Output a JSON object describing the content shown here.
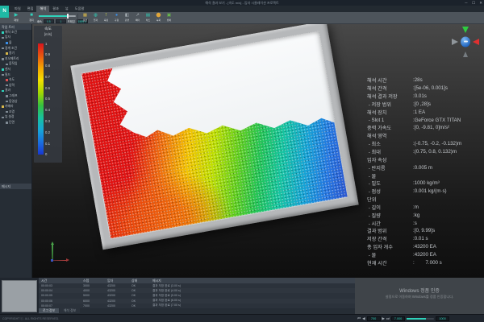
{
  "theme": {
    "accent_teal": "#2fd2bb",
    "panel_dark": "#272e36",
    "ribbon_gray": "#4d545b",
    "viewport_top": "#484848"
  },
  "window": {
    "title": "해석 결과 보기 - [속도 m/s] - 입자 시뮬레이션 프로젝트",
    "controls": [
      "－",
      "☐",
      "✕"
    ],
    "logo": "N"
  },
  "menu": {
    "items": [
      "파일",
      "편집",
      "해석",
      "결과",
      "뷰",
      "도움말"
    ],
    "active_index": 2
  },
  "toolbar": {
    "transport": [
      {
        "glyph": "▶",
        "label": "재생"
      },
      {
        "glyph": "■",
        "label": "정지"
      }
    ],
    "fields": [
      {
        "label": "배속",
        "value": "0.5"
      },
      {
        "label": "",
        "value": "1"
      },
      {
        "label": "프레임",
        "value": "1배속 ▾"
      }
    ],
    "icons": [
      {
        "glyph": "▦",
        "label": "장면",
        "color": "#d8b84a"
      },
      {
        "glyph": "◍",
        "label": "입자",
        "color": "#2fd2bb"
      },
      {
        "glyph": "⊺",
        "label": "측정",
        "color": "#cdd24a"
      },
      {
        "glyph": "●",
        "label": "구형",
        "color": "#3a8fe8"
      },
      {
        "glyph": "◧",
        "label": "단면",
        "color": "#aab2b8"
      },
      {
        "glyph": "↗",
        "label": "벡터",
        "color": "#aab2b8"
      },
      {
        "glyph": "▤",
        "label": "차트",
        "color": "#2fd2bb"
      },
      {
        "glyph": "⬤",
        "label": "녹화",
        "color": "#e0a53a"
      },
      {
        "glyph": "▣",
        "label": "캡처",
        "color": "#6abf4a"
      }
    ]
  },
  "tree": {
    "header": "작업 트리",
    "items": [
      {
        "label": "해석 조건",
        "depth": 0,
        "color": "#2fd2bb"
      },
      {
        "label": "입자",
        "depth": 0,
        "color": "#7f8a94"
      },
      {
        "label": "물",
        "depth": 1,
        "color": "#3a8fe8"
      },
      {
        "label": "경계 조건",
        "depth": 0,
        "color": "#7f8a94"
      },
      {
        "label": "용기",
        "depth": 1,
        "color": "#d8b84a"
      },
      {
        "label": "지오메트리",
        "depth": 0,
        "color": "#7f8a94"
      },
      {
        "label": "움직임",
        "depth": 1,
        "color": "#7f8a94"
      },
      {
        "label": "센서",
        "depth": 0,
        "color": "#2fd2bb"
      },
      {
        "label": "필드",
        "depth": 0,
        "color": "#7f8a94"
      },
      {
        "label": "속도",
        "depth": 1,
        "color": "#e05050"
      },
      {
        "label": "압력",
        "depth": 1,
        "color": "#7f8a94"
      },
      {
        "label": "결과",
        "depth": 0,
        "color": "#2fd2bb"
      },
      {
        "label": "그래프",
        "depth": 1,
        "color": "#7f8a94"
      },
      {
        "label": "동영상",
        "depth": 1,
        "color": "#7f8a94"
      },
      {
        "label": "카메라",
        "depth": 0,
        "color": "#d8b84a"
      },
      {
        "label": "조명",
        "depth": 1,
        "color": "#7f8a94"
      },
      {
        "label": "뷰 설정",
        "depth": 0,
        "color": "#7f8a94"
      },
      {
        "label": "단면",
        "depth": 1,
        "color": "#7f8a94"
      }
    ]
  },
  "message_panel": {
    "header": "메시지"
  },
  "legend": {
    "title": "속도",
    "unit": "[m/s]",
    "ticks": [
      "1",
      "0.9",
      "0.8",
      "0.7",
      "0.6",
      "0.5",
      "0.4",
      "0.3",
      "0.2",
      "0.1",
      "0"
    ],
    "colors_top_to_bottom": [
      "#d8141c",
      "#f4a500",
      "#f4e000",
      "#35c040",
      "#17a6d8",
      "#1837d0"
    ]
  },
  "viewport": {
    "info_lines": [
      {
        "label": "해석 시간",
        "value": ":28s"
      },
      {
        "label": "해석 간격",
        "value": ":[5e-06, 0.001]s"
      },
      {
        "label": "해석 결과 저장",
        "value": ":0.01s"
      },
      {
        "label": " - 저장 범위",
        "value": ":[0 ,28]s"
      },
      {
        "label": "해석 장치",
        "value": ":1 EA"
      },
      {
        "label": " - Slot 1",
        "value": ":GeForce GTX TITAN"
      },
      {
        "label": "중력 가속도",
        "value": ":[0, -9.81, 0]m/s²"
      },
      {
        "label": "해석 영역",
        "value": ""
      },
      {
        "label": " - 최소",
        "value": ":(-0.75, -0.2, -0.132)m"
      },
      {
        "label": " - 최대",
        "value": ":(0.75, 0.8, 0.132)m"
      },
      {
        "label": "입자 속성",
        "value": ""
      },
      {
        "label": " - 반지름",
        "value": ":0.005 m"
      },
      {
        "label": " - 물",
        "value": ""
      },
      {
        "label": " - 밀도",
        "value": ":1000 kg/m³"
      },
      {
        "label": " - 점성",
        "value": ":0.001 kg/(m·s)"
      },
      {
        "label": "단위",
        "value": ""
      },
      {
        "label": " - 길이",
        "value": ":m"
      },
      {
        "label": " - 질량",
        "value": ":kg"
      },
      {
        "label": " - 시간",
        "value": ":s"
      },
      {
        "label": "결과 범위",
        "value": ":[0, 9.99]s"
      },
      {
        "label": "저장 간격",
        "value": ":0.01 s"
      },
      {
        "label": "총 입자 개수",
        "value": ":43200 EA"
      },
      {
        "label": " - 물",
        "value": ":43200 EA"
      },
      {
        "label": "현재 시간",
        "value": ":        7.000 s"
      }
    ],
    "watermark": {
      "line1": "Windows 정품 인증",
      "line2": "설정으로 이동하여 Windows를 정품 인증합니다."
    }
  },
  "log": {
    "headers": [
      "시간",
      "스텝",
      "입자",
      "상태",
      "메시지"
    ],
    "rows": [
      [
        "00:00:03",
        "3000",
        "43200",
        "OK",
        "결과 저장 완료 (3.00 s)"
      ],
      [
        "00:00:04",
        "4000",
        "43200",
        "OK",
        "결과 저장 완료 (4.00 s)"
      ],
      [
        "00:00:05",
        "5000",
        "43200",
        "OK",
        "결과 저장 완료 (5.00 s)"
      ],
      [
        "00:00:06",
        "6000",
        "43200",
        "OK",
        "결과 저장 완료 (6.00 s)"
      ],
      [
        "00:00:07",
        "7000",
        "43200",
        "OK",
        "결과 저장 완료 (7.00 s)"
      ]
    ],
    "tabs": [
      "로그 정보",
      "해석 정보"
    ]
  },
  "status": {
    "copyright": "COPYRIGHT ⓒ. ALL RIGHTS RESERVED.",
    "playback": {
      "buttons": [
        "⏮",
        "◀",
        "▶",
        "⏭"
      ],
      "frame": "700",
      "current": "7.000",
      "total": "1000"
    }
  }
}
